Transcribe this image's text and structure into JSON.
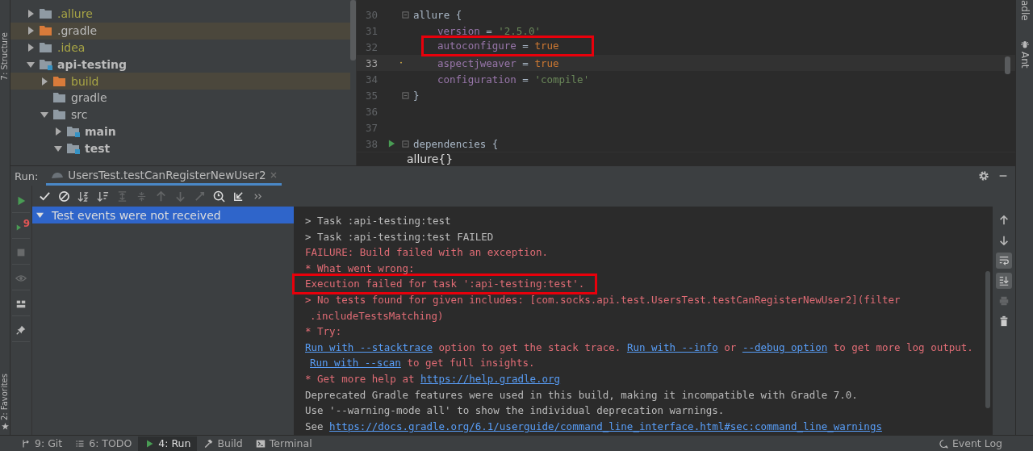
{
  "left_strip": {
    "top_label": "7: Structure",
    "bottom_label": "2: Favorites"
  },
  "right_strip": {
    "labels": [
      "adle",
      "Ant"
    ]
  },
  "project_tree": [
    {
      "name": ".allure",
      "kind": "plain",
      "excluded": true,
      "highlighted": false,
      "expandable": true,
      "expanded": false,
      "bold": false
    },
    {
      "name": ".gradle",
      "kind": "orange",
      "excluded": false,
      "highlighted": true,
      "expandable": true,
      "expanded": false,
      "bold": false
    },
    {
      "name": ".idea",
      "kind": "plain",
      "excluded": true,
      "highlighted": false,
      "expandable": true,
      "expanded": false,
      "bold": false
    },
    {
      "name": "api-testing",
      "kind": "module",
      "excluded": false,
      "highlighted": false,
      "expandable": true,
      "expanded": true,
      "bold": true,
      "children": [
        {
          "name": "build",
          "kind": "orange",
          "excluded": true,
          "highlighted": true,
          "expandable": true,
          "expanded": false,
          "bold": false
        },
        {
          "name": "gradle",
          "kind": "plain",
          "excluded": false,
          "highlighted": false,
          "expandable": false,
          "bold": false
        },
        {
          "name": "src",
          "kind": "plain",
          "excluded": false,
          "highlighted": false,
          "expandable": true,
          "expanded": true,
          "bold": false,
          "children": [
            {
              "name": "main",
              "kind": "module",
              "excluded": false,
              "highlighted": false,
              "expandable": true,
              "expanded": false,
              "bold": true
            },
            {
              "name": "test",
              "kind": "module",
              "excluded": false,
              "highlighted": false,
              "expandable": true,
              "expanded": true,
              "bold": true
            }
          ]
        }
      ]
    }
  ],
  "editor": {
    "lines": [
      {
        "number": "30",
        "indent": false,
        "fold": true,
        "run": false,
        "current": false,
        "annotated": false,
        "tokens": [
          {
            "text": "allure {",
            "kind": "plain"
          }
        ]
      },
      {
        "number": "31",
        "indent": true,
        "fold": false,
        "run": false,
        "current": false,
        "annotated": false,
        "tokens": [
          {
            "text": "version",
            "kind": "property"
          },
          {
            "text": " = ",
            "kind": "plain"
          },
          {
            "text": "'2.5.0'",
            "kind": "string"
          }
        ]
      },
      {
        "number": "32",
        "indent": true,
        "fold": false,
        "run": false,
        "current": false,
        "annotated": true,
        "tokens": [
          {
            "text": "autoconfigure",
            "kind": "property"
          },
          {
            "text": " = ",
            "kind": "plain"
          },
          {
            "text": "true",
            "kind": "keyword"
          }
        ]
      },
      {
        "number": "33",
        "indent": true,
        "fold": false,
        "run": false,
        "current": true,
        "annotated": false,
        "tokens": [
          {
            "text": "aspectjweaver",
            "kind": "property"
          },
          {
            "text": " = ",
            "kind": "plain"
          },
          {
            "text": "true",
            "kind": "keyword"
          }
        ]
      },
      {
        "number": "34",
        "indent": true,
        "fold": false,
        "run": false,
        "current": false,
        "annotated": false,
        "tokens": [
          {
            "text": "configuration",
            "kind": "property"
          },
          {
            "text": " = ",
            "kind": "plain"
          },
          {
            "text": "'compile'",
            "kind": "string"
          }
        ]
      },
      {
        "number": "35",
        "indent": false,
        "fold": true,
        "run": false,
        "current": false,
        "annotated": false,
        "tokens": [
          {
            "text": "}",
            "kind": "plain"
          }
        ]
      },
      {
        "number": "36",
        "fold": false,
        "run": false,
        "current": false
      },
      {
        "number": "37",
        "fold": false,
        "run": false,
        "current": false
      },
      {
        "number": "38",
        "indent": false,
        "fold": true,
        "run": true,
        "current": false,
        "annotated": false,
        "tokens": [
          {
            "text": "dependencies {",
            "kind": "plain"
          }
        ]
      }
    ],
    "breadcrumb": "allure{}"
  },
  "run_panel": {
    "title": "Run:",
    "tabs": [
      {
        "label": "UsersTest.testCanRegisterNewUser2",
        "selected": true
      }
    ],
    "side_tools": [
      {
        "kind": "play",
        "disabled": false
      },
      {
        "kind": "rerun",
        "badge": "9",
        "disabled": false
      },
      {
        "kind": "stop",
        "disabled": true
      },
      {
        "kind": "eye",
        "disabled": true
      },
      {
        "kind": "layout",
        "disabled": false
      },
      {
        "kind": "pin",
        "disabled": false
      }
    ],
    "toolbar": [
      {
        "kind": "check",
        "disabled": false
      },
      {
        "kind": "cancel",
        "disabled": false
      },
      {
        "kind": "sort-alpha",
        "disabled": false
      },
      {
        "kind": "sort-duration",
        "disabled": false
      },
      {
        "kind": "expand",
        "disabled": true
      },
      {
        "kind": "collapse",
        "disabled": true
      },
      {
        "kind": "up",
        "disabled": true
      },
      {
        "kind": "down",
        "disabled": true
      },
      {
        "kind": "rerun-small",
        "disabled": true
      },
      {
        "kind": "clock",
        "disabled": false
      },
      {
        "kind": "import",
        "disabled": false
      },
      {
        "kind": "more",
        "disabled": false
      }
    ],
    "test_tree": [
      {
        "label": "Test events were not received",
        "expanded": true,
        "selected": true
      }
    ],
    "console": [
      {
        "indent": false,
        "annotated": false,
        "parts": [
          {
            "text": "> Task :api-testing:test",
            "kind": "normal"
          }
        ]
      },
      {
        "indent": false,
        "annotated": false,
        "parts": [
          {
            "text": "> Task :api-testing:test FAILED",
            "kind": "normal"
          }
        ]
      },
      {
        "indent": false,
        "annotated": false,
        "parts": [
          {
            "text": "FAILURE: Build failed with an exception.",
            "kind": "error"
          }
        ]
      },
      {
        "indent": false,
        "annotated": false,
        "parts": [
          {
            "text": "* What went wrong:",
            "kind": "error"
          }
        ]
      },
      {
        "indent": false,
        "annotated": true,
        "parts": [
          {
            "text": "Execution failed for task ':api-testing:test'.",
            "kind": "error"
          }
        ]
      },
      {
        "indent": false,
        "annotated": false,
        "parts": [
          {
            "text": "> No tests found for given includes: [com.socks.api.test.UsersTest.testCanRegisterNewUser2](filter",
            "kind": "error"
          }
        ]
      },
      {
        "indent": true,
        "annotated": false,
        "parts": [
          {
            "text": ".includeTestsMatching)",
            "kind": "error"
          }
        ]
      },
      {
        "indent": false,
        "annotated": false,
        "parts": [
          {
            "text": "* Try:",
            "kind": "error"
          }
        ]
      },
      {
        "indent": false,
        "annotated": false,
        "parts": [
          {
            "text": "Run with --stacktrace",
            "kind": "link"
          },
          {
            "text": " option to get the stack trace. ",
            "kind": "error"
          },
          {
            "text": "Run with --info",
            "kind": "link"
          },
          {
            "text": " or ",
            "kind": "error"
          },
          {
            "text": "--debug option",
            "kind": "link"
          },
          {
            "text": " to get more log output.",
            "kind": "error"
          }
        ]
      },
      {
        "indent": true,
        "annotated": false,
        "parts": [
          {
            "text": "Run with --scan",
            "kind": "link"
          },
          {
            "text": " to get full insights.",
            "kind": "error"
          }
        ]
      },
      {
        "indent": false,
        "annotated": false,
        "parts": [
          {
            "text": "* Get more help at ",
            "kind": "error"
          },
          {
            "text": "https://help.gradle.org",
            "kind": "link"
          }
        ]
      },
      {
        "indent": false,
        "annotated": false,
        "parts": [
          {
            "text": "Deprecated Gradle features were used in this build, making it incompatible with Gradle 7.0.",
            "kind": "normal"
          }
        ]
      },
      {
        "indent": false,
        "annotated": false,
        "parts": [
          {
            "text": "Use '--warning-mode all' to show the individual deprecation warnings.",
            "kind": "normal"
          }
        ]
      },
      {
        "indent": false,
        "annotated": false,
        "parts": [
          {
            "text": "See ",
            "kind": "normal"
          },
          {
            "text": "https://docs.gradle.org/6.1/userguide/command_line_interface.html#sec:command_line_warnings",
            "kind": "link"
          }
        ]
      }
    ],
    "console_tools": [
      {
        "kind": "up",
        "on": false,
        "disabled": false
      },
      {
        "kind": "down",
        "on": false,
        "disabled": false
      },
      {
        "kind": "wrap",
        "on": true,
        "disabled": false
      },
      {
        "kind": "scroll-end",
        "on": true,
        "disabled": false
      },
      {
        "kind": "print",
        "on": false,
        "disabled": true
      },
      {
        "kind": "trash",
        "on": false,
        "disabled": false
      }
    ]
  },
  "bottom_bar": {
    "tabs": [
      {
        "label": "9: Git",
        "kind": "git",
        "selected": false
      },
      {
        "label": "6: TODO",
        "kind": "list",
        "selected": false
      },
      {
        "label": "4: Run",
        "kind": "play",
        "selected": true
      },
      {
        "label": "Build",
        "kind": "hammer",
        "selected": false
      },
      {
        "label": "Terminal",
        "kind": "terminal",
        "selected": false
      }
    ],
    "event_log": "Event Log"
  }
}
